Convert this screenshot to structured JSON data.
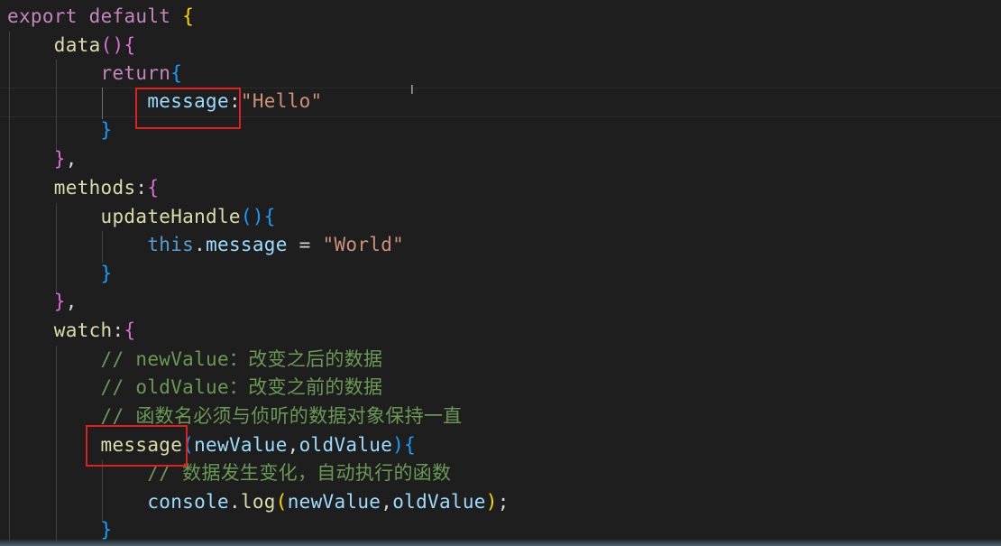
{
  "editor": {
    "lines": {
      "l1": {
        "kw": "export",
        "kw2": "default",
        "brace": "{"
      },
      "l2": {
        "fn": "data",
        "paren": "()",
        "brace": "{"
      },
      "l3": {
        "kw": "return",
        "brace": "{"
      },
      "l4": {
        "prop": "message",
        "colon": ":",
        "str": "\"Hello\""
      },
      "l5": {
        "brace": "}"
      },
      "l6": {
        "brace": "}",
        "comma": ","
      },
      "l7": {
        "fn": "methods",
        "colon": ":",
        "brace": "{"
      },
      "l8": {
        "fn": "updateHandle",
        "paren": "()",
        "brace": "{"
      },
      "l9": {
        "this": "this",
        "dot": ".",
        "prop": "message",
        "eq": " = ",
        "str": "\"World\""
      },
      "l10": {
        "brace": "}"
      },
      "l11": {
        "brace": "}",
        "comma": ","
      },
      "l12": {
        "fn": "watch",
        "colon": ":",
        "brace": "{"
      },
      "l13": {
        "comment": "// newValue：改变之后的数据"
      },
      "l14": {
        "comment": "// oldValue：改变之前的数据"
      },
      "l15": {
        "comment": "// 函数名必须与侦听的数据对象保持一直"
      },
      "l16": {
        "fn": "message",
        "open": "(",
        "p1": "newValue",
        "comma": ",",
        "p2": "oldValue",
        "close": ")",
        "brace": "{"
      },
      "l17": {
        "comment": "// 数据发生变化，自动执行的函数"
      },
      "l18": {
        "obj": "console",
        "dot": ".",
        "fn": "log",
        "open": "(",
        "p1": "newValue",
        "comma": ",",
        "p2": "oldValue",
        "close": ")",
        "semi": ";"
      },
      "l19": {
        "brace": "}"
      }
    }
  },
  "colors": {
    "background": "#1e1e1e",
    "keyword": "#c586c0",
    "function": "#dcdcaa",
    "property": "#9cdcfe",
    "string": "#ce9178",
    "comment": "#6a9955",
    "highlight_box": "#e02020"
  },
  "cursor": {
    "icon": "text-cursor-icon",
    "glyph": "I"
  }
}
